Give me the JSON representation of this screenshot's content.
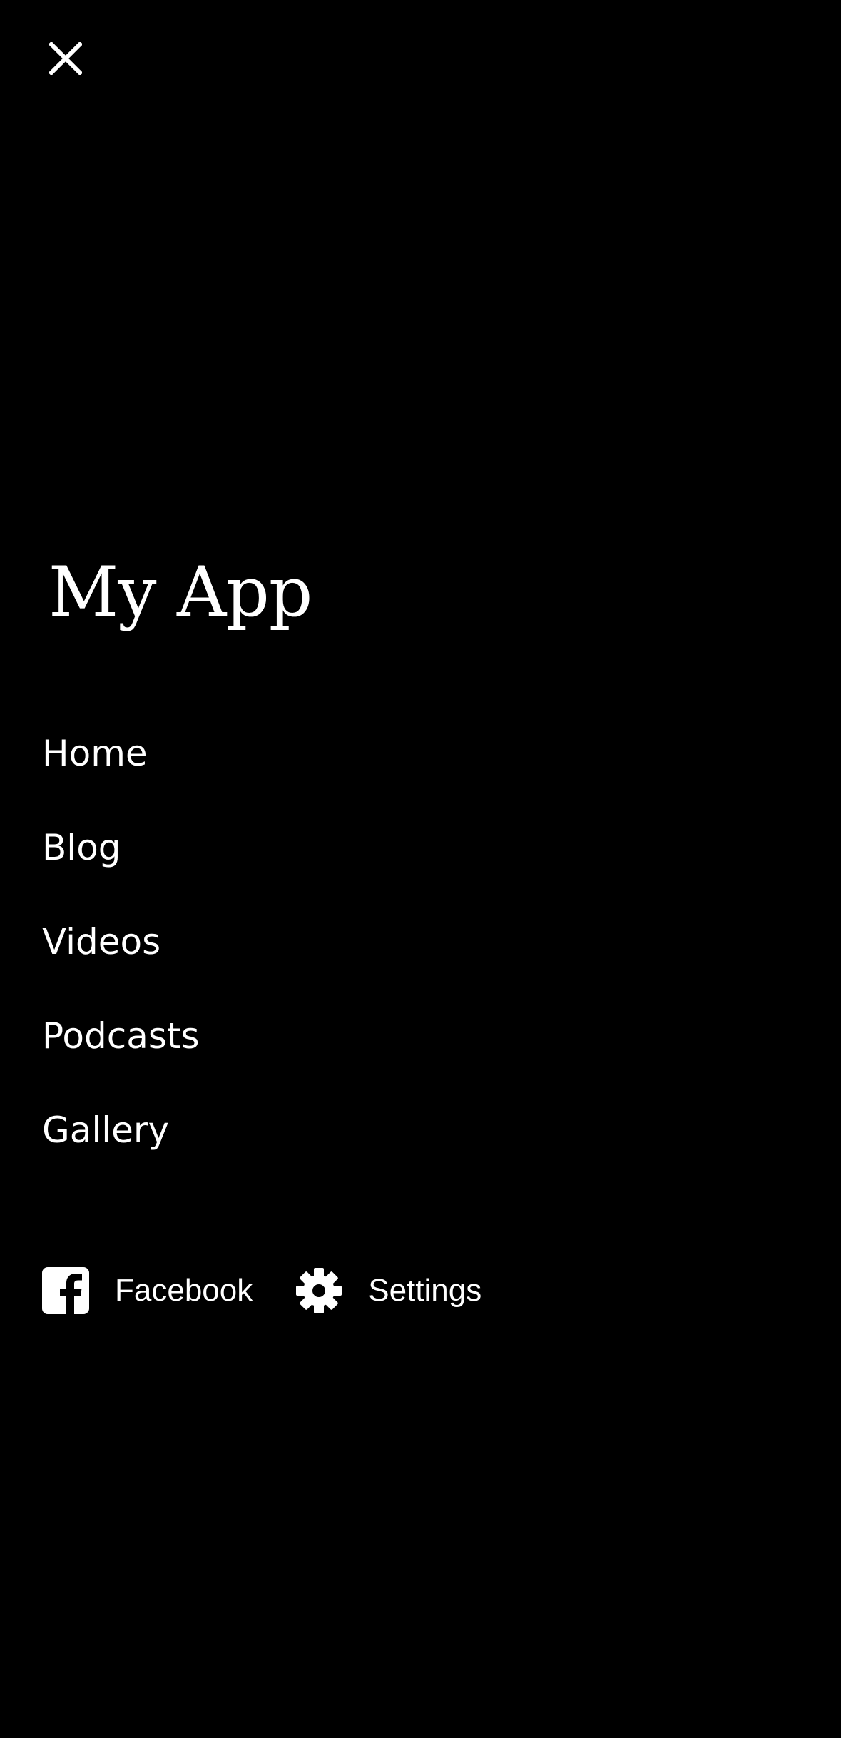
{
  "menu": {
    "close_icon": "close-icon",
    "app_title": "My App",
    "items": [
      {
        "label": "Home"
      },
      {
        "label": "Blog"
      },
      {
        "label": "Videos"
      },
      {
        "label": "Podcasts"
      },
      {
        "label": "Gallery"
      }
    ],
    "footer": [
      {
        "label": "Facebook",
        "icon": "facebook-icon"
      },
      {
        "label": "Settings",
        "icon": "gear-icon"
      }
    ]
  },
  "colors": {
    "background": "#000000",
    "text": "#ffffff"
  }
}
